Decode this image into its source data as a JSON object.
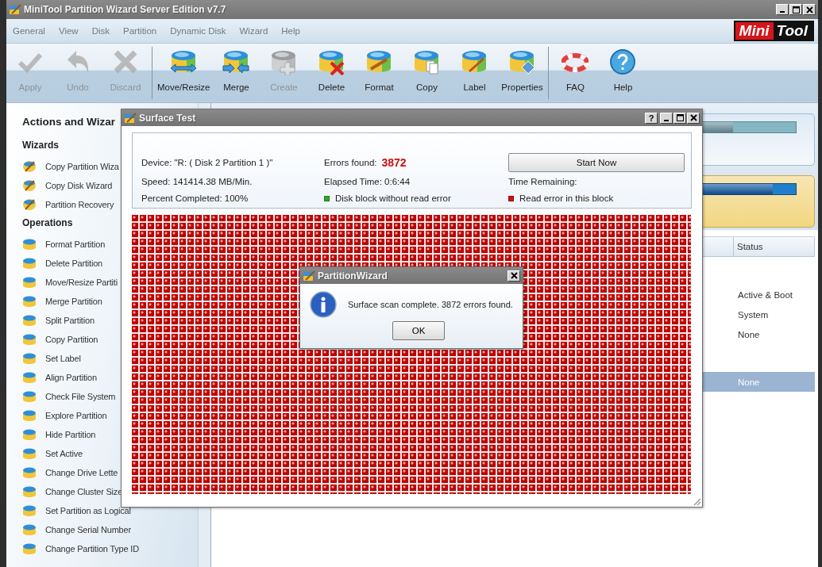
{
  "window": {
    "title": "MiniTool Partition Wizard Server Edition v7.7"
  },
  "menu": [
    "General",
    "View",
    "Disk",
    "Partition",
    "Dynamic Disk",
    "Wizard",
    "Help"
  ],
  "logo": [
    "Mini",
    "Tool"
  ],
  "toolbar": [
    {
      "items": [
        {
          "label": "Apply",
          "disabled": true
        },
        {
          "label": "Undo",
          "disabled": true
        },
        {
          "label": "Discard",
          "disabled": true
        }
      ]
    },
    {
      "items": [
        {
          "label": "Move/Resize",
          "disabled": false
        },
        {
          "label": "Merge",
          "disabled": false
        },
        {
          "label": "Create",
          "disabled": true
        },
        {
          "label": "Delete",
          "disabled": false
        },
        {
          "label": "Format",
          "disabled": false
        },
        {
          "label": "Copy",
          "disabled": false
        },
        {
          "label": "Label",
          "disabled": false
        },
        {
          "label": "Properties",
          "disabled": false
        }
      ]
    },
    {
      "items": [
        {
          "label": "FAQ",
          "disabled": false
        },
        {
          "label": "Help",
          "disabled": false
        }
      ]
    }
  ],
  "sidebar": {
    "title": "Actions and Wizar",
    "sections": [
      {
        "heading": "Wizards",
        "items": [
          "Copy Partition Wiza",
          "Copy Disk Wizard",
          "Partition Recovery"
        ]
      },
      {
        "heading": "Operations",
        "items": [
          "Format Partition",
          "Delete Partition",
          "Move/Resize Partiti",
          "Merge Partition",
          "Split Partition",
          "Copy Partition",
          "Set Label",
          "Align Partition",
          "Check File System",
          "Explore Partition",
          "Hide Partition",
          "Set Active",
          "Change Drive Lette",
          "Change Cluster Size",
          "Set Partition as Logical",
          "Change Serial Number",
          "Change Partition Type ID"
        ]
      }
    ]
  },
  "disk_map": [
    {
      "selected": false,
      "level": 0.89
    },
    {
      "selected": true,
      "level": 0.96
    }
  ],
  "partition_table": {
    "columns": [
      "Status"
    ],
    "rows": [
      {
        "kind": "disk"
      },
      {
        "kind": "partition",
        "status": "Active & Boot",
        "selected": false
      },
      {
        "kind": "partition",
        "status": "System",
        "selected": false
      },
      {
        "kind": "partition",
        "status": "None",
        "selected": false
      },
      {
        "kind": "disk"
      },
      {
        "kind": "partition",
        "status": "None",
        "selected": true
      }
    ]
  },
  "surface_test": {
    "title": "Surface Test",
    "help_button": "?",
    "device": "Device:  \"R: ( Disk 2 Partition 1 )\"",
    "speed": "Speed:  141414.38 MB/Min.",
    "percent": "Percent Completed:  100%",
    "errors_label": "Errors found:",
    "errors_value": "3872",
    "elapsed": "Elapsed Time:  0:6:44",
    "start_button": "Start Now",
    "time_remaining": "Time Remaining:",
    "legend": [
      {
        "label": "Disk block without read error",
        "color": "#2fa52f"
      },
      {
        "label": "Read error in this block",
        "color": "#d01010"
      }
    ]
  },
  "message_box": {
    "title": "PartitionWizard",
    "text": "Surface scan complete. 3872 errors found.",
    "button": "OK"
  }
}
